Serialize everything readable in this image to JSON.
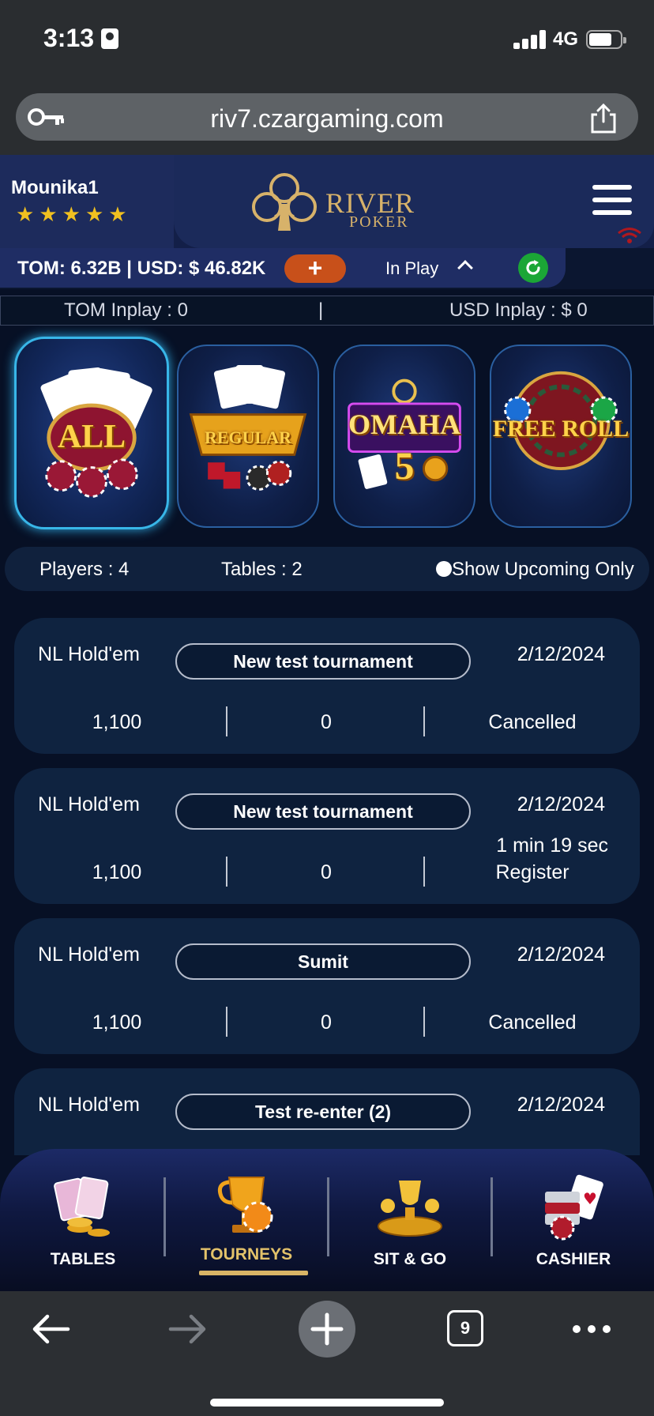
{
  "status_bar": {
    "time": "3:13",
    "network": "4G"
  },
  "browser": {
    "url": "riv7.czargaming.com",
    "tab_count": "9"
  },
  "header": {
    "username": "Mounika1",
    "stars": 5,
    "logo_line1": "RIVER",
    "logo_line2": "POKER",
    "balance": "TOM: 6.32B | USD: $ 46.82K",
    "add_label": "+",
    "in_play_label": "In Play"
  },
  "inplay": {
    "tom": "TOM Inplay : 0",
    "separator": "|",
    "usd": "USD Inplay : $ 0"
  },
  "categories": [
    {
      "label": "ALL",
      "active": true
    },
    {
      "label": "REGULAR",
      "active": false
    },
    {
      "label": "OMAHA",
      "sub": "5",
      "active": false
    },
    {
      "label": "FREE ROLL",
      "active": false
    }
  ],
  "filters": {
    "players": "Players : 4",
    "tables": "Tables : 2",
    "upcoming_toggle": "Show Upcoming Only"
  },
  "tournaments": [
    {
      "game": "NL Hold'em",
      "name": "New test tournament",
      "date": "2/12/2024",
      "countdown": "",
      "buyin": "1,100",
      "players": "0",
      "status": "Cancelled"
    },
    {
      "game": "NL Hold'em",
      "name": "New test tournament",
      "date": "2/12/2024",
      "countdown": "1 min 19 sec",
      "buyin": "1,100",
      "players": "0",
      "status": "Register"
    },
    {
      "game": "NL Hold'em",
      "name": "Sumit",
      "date": "2/12/2024",
      "countdown": "",
      "buyin": "1,100",
      "players": "0",
      "status": "Cancelled"
    },
    {
      "game": "NL Hold'em",
      "name": "Test re-enter (2)",
      "date": "2/12/2024",
      "countdown": "",
      "buyin": "",
      "players": "",
      "status": ""
    }
  ],
  "nav": {
    "tables": "TABLES",
    "tourneys": "TOURNEYS",
    "sitgo": "SIT & GO",
    "cashier": "CASHIER",
    "active": "tourneys"
  },
  "colors": {
    "accent_gold": "#d9b566",
    "add_orange": "#c8501a",
    "refresh_green": "#1ba636",
    "tile_glow": "#38b6e8"
  }
}
